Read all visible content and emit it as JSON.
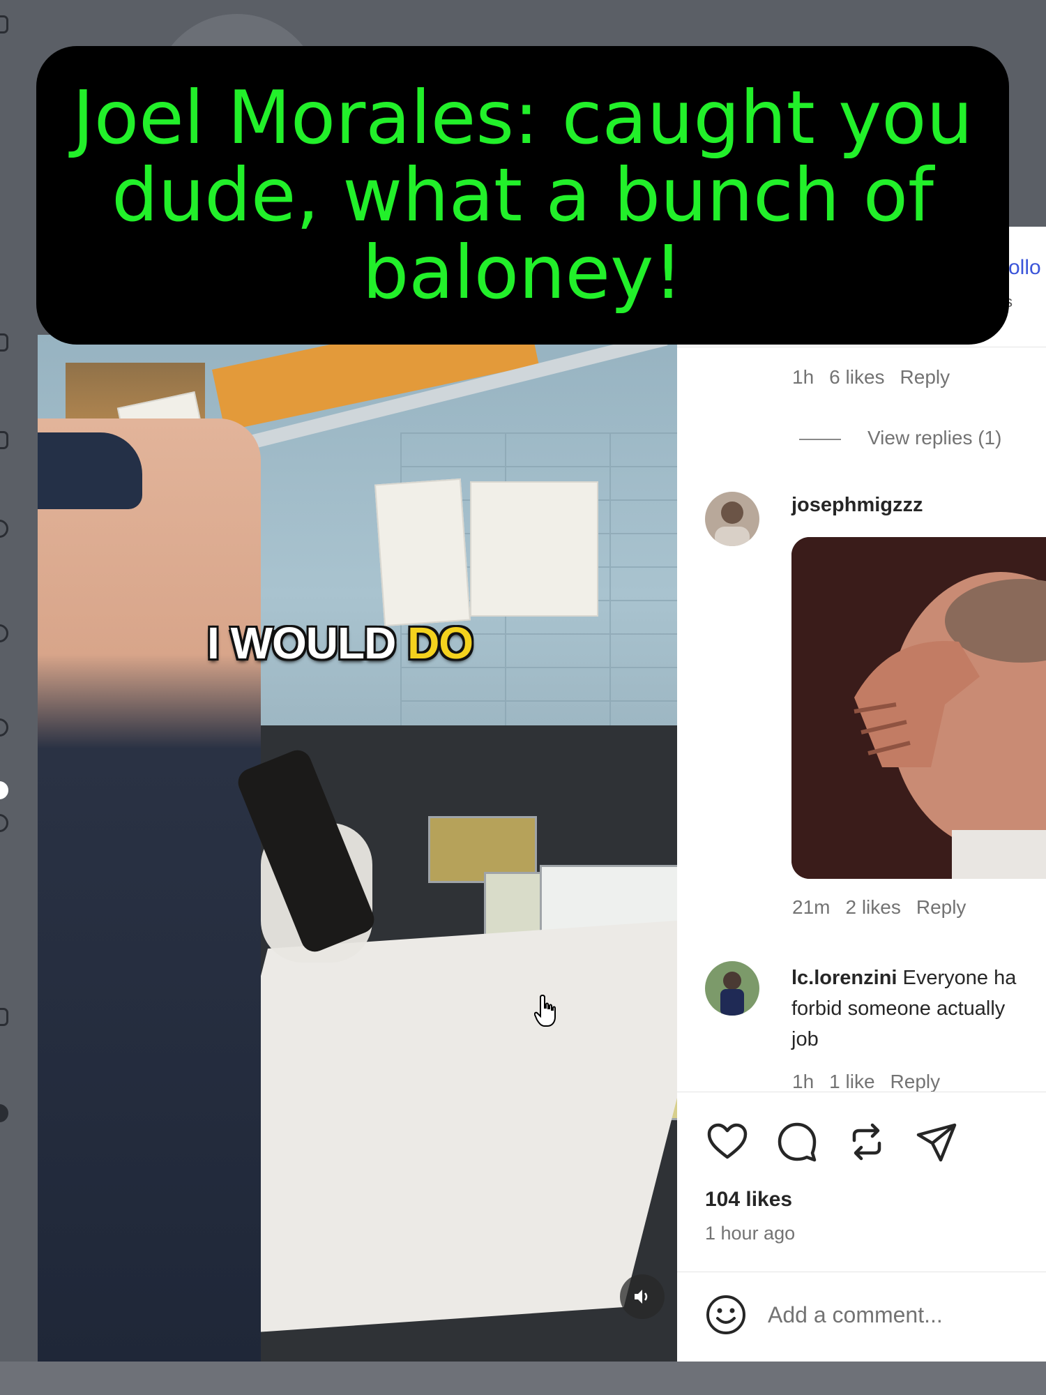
{
  "banner": {
    "text": "Joel Morales: caught you dude, what a bunch of baloney!"
  },
  "video": {
    "caption_word_1": "I WOULD ",
    "caption_word_2": "DO",
    "mute_icon": "volume-icon"
  },
  "post_header": {
    "follow_label": "ollo",
    "sub_label": "s"
  },
  "comments": [
    {
      "id": "first",
      "time": "1h",
      "likes": "6 likes",
      "reply_label": "Reply",
      "view_replies": "View replies (1)"
    },
    {
      "id": "josephmigzzz",
      "username": "josephmigzzz",
      "time": "21m",
      "likes": "2 likes",
      "reply_label": "Reply",
      "attachment": "facepalm-gif"
    },
    {
      "id": "lc.lorenzini",
      "username": "lc.lorenzini",
      "text_line_1": "Everyone ha",
      "text_line_2": "forbid someone actually",
      "text_line_3": "job",
      "time": "1h",
      "likes": "1 like",
      "reply_label": "Reply"
    }
  ],
  "actions": {
    "icons": [
      "heart-icon",
      "comment-icon",
      "repost-icon",
      "share-icon"
    ],
    "likes": "104 likes",
    "time_ago": "1 hour ago"
  },
  "composer": {
    "placeholder": "Add a comment...",
    "emoji_icon": "emoji-icon"
  },
  "colors": {
    "banner_bg": "#000000",
    "banner_text": "#22F02A",
    "caption_highlight": "#F4D21E",
    "link_blue": "#3B55D9"
  }
}
